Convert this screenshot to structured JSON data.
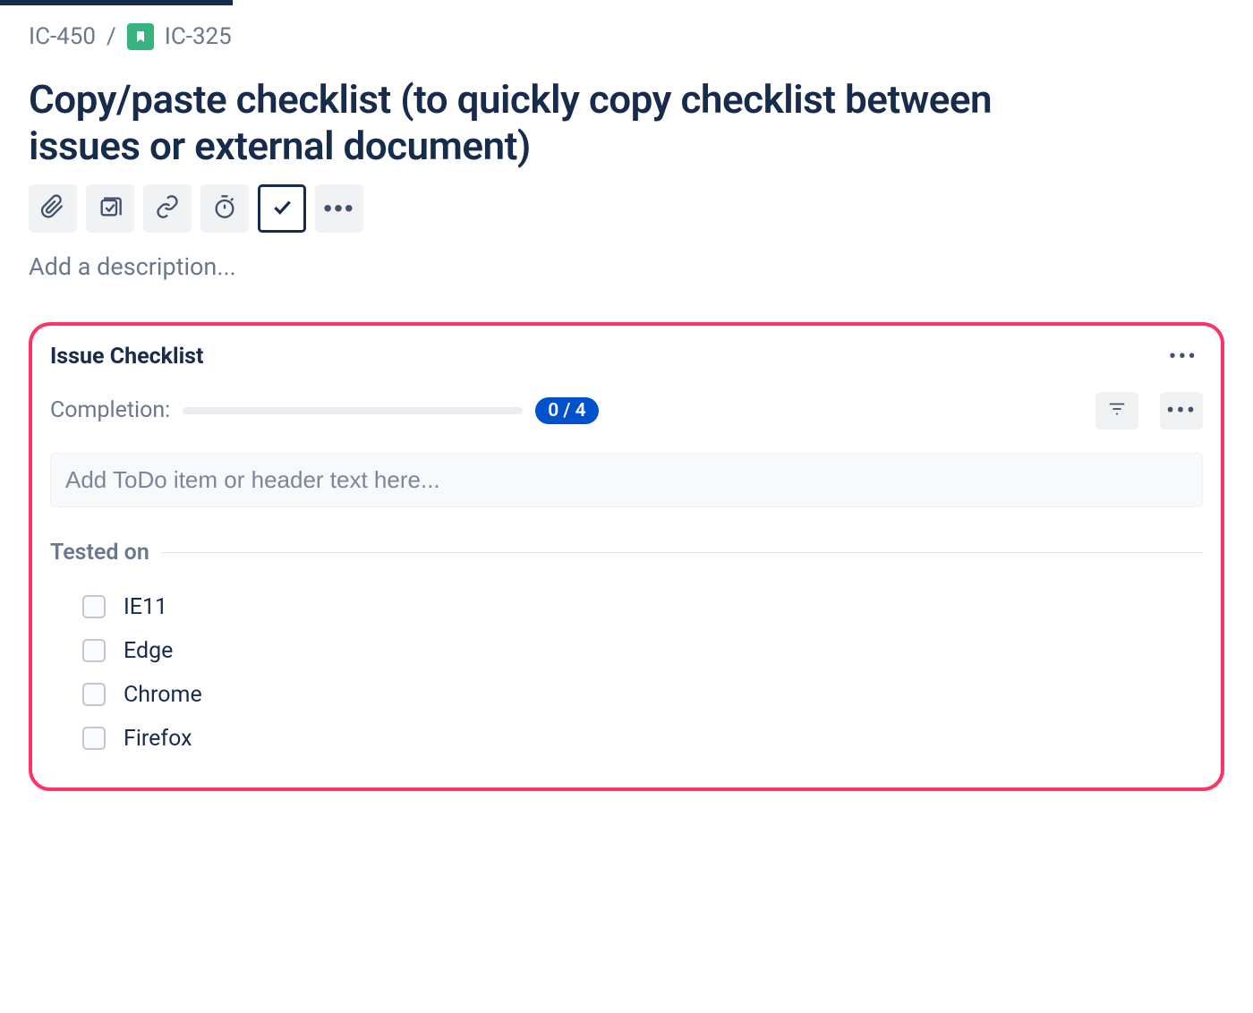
{
  "breadcrumb": {
    "parent": "IC-450",
    "separator": "/",
    "current": "IC-325"
  },
  "issue": {
    "title": "Copy/paste checklist (to quickly copy checklist between issues or external document)",
    "description_placeholder": "Add a description..."
  },
  "toolbar": {
    "attach": "attachment",
    "vote": "vote",
    "link": "link",
    "timer": "stopwatch",
    "checklist": "checklist",
    "more": "•••"
  },
  "checklist": {
    "title": "Issue Checklist",
    "header_more": "•••",
    "completion_label": "Completion:",
    "completion_badge": "0 / 4",
    "add_placeholder": "Add ToDo item or header text here...",
    "filter_icon": "filter",
    "controls_more": "•••",
    "group_label": "Tested on",
    "items": [
      {
        "label": "IE11",
        "checked": false
      },
      {
        "label": "Edge",
        "checked": false
      },
      {
        "label": "Chrome",
        "checked": false
      },
      {
        "label": "Firefox",
        "checked": false
      }
    ]
  }
}
